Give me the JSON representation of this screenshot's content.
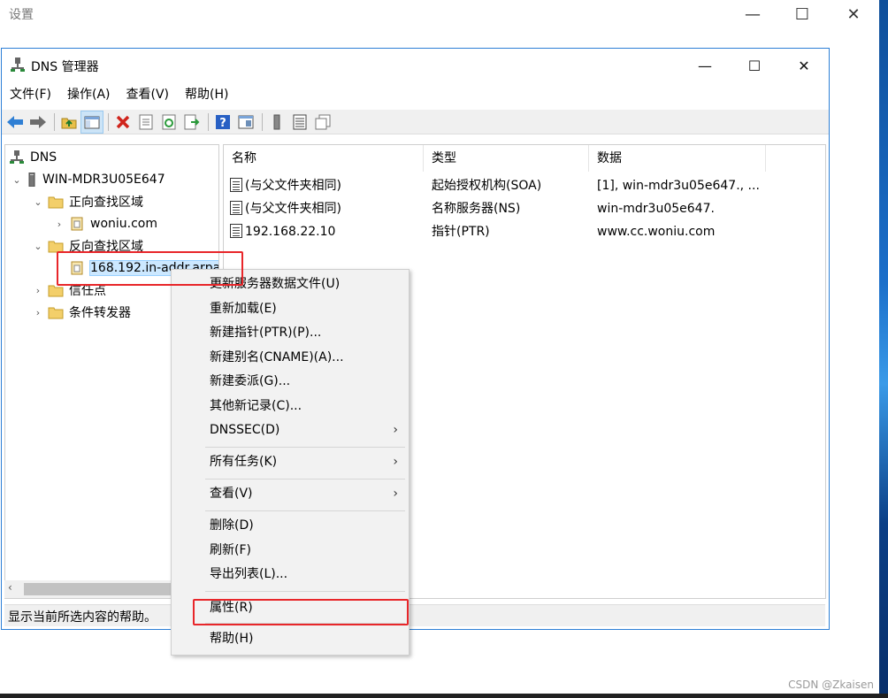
{
  "settings_window": {
    "title": "设置"
  },
  "dns_window": {
    "title": "DNS 管理器",
    "menu": [
      "文件(F)",
      "操作(A)",
      "查看(V)",
      "帮助(H)"
    ]
  },
  "tree": {
    "root": "DNS",
    "server": "WIN-MDR3U05E647",
    "forward_zones": "正向查找区域",
    "forward_zone_1": "woniu.com",
    "reverse_zones": "反向查找区域",
    "reverse_zone_1": "168.192.in-addr.arpa",
    "trust_points": "信任点",
    "conditional_forwarders": "条件转发器"
  },
  "list": {
    "columns": [
      "名称",
      "类型",
      "数据"
    ],
    "rows": [
      {
        "name": "(与父文件夹相同)",
        "type": "起始授权机构(SOA)",
        "data": "[1], win-mdr3u05e647., ..."
      },
      {
        "name": "(与父文件夹相同)",
        "type": "名称服务器(NS)",
        "data": "win-mdr3u05e647."
      },
      {
        "name": "192.168.22.10",
        "type": "指针(PTR)",
        "data": "www.cc.woniu.com"
      }
    ]
  },
  "status_text": "显示当前所选内容的帮助。",
  "context_menu": {
    "items": [
      "更新服务器数据文件(U)",
      "重新加载(E)",
      "新建指针(PTR)(P)...",
      "新建别名(CNAME)(A)...",
      "新建委派(G)...",
      "其他新记录(C)...",
      "DNSSEC(D)",
      "所有任务(K)",
      "查看(V)",
      "删除(D)",
      "刷新(F)",
      "导出列表(L)...",
      "属性(R)",
      "帮助(H)"
    ]
  },
  "watermark": "CSDN @Zkaisen",
  "colors": {
    "highlight": "#e8262a",
    "selection": "#cce8ff",
    "window_border": "#2d7fd6"
  }
}
